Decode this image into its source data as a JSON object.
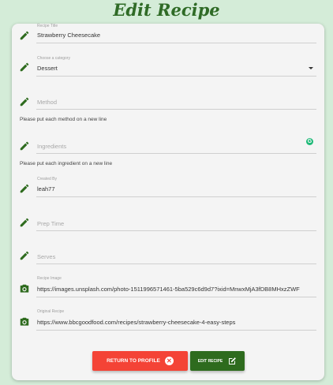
{
  "page": {
    "title": "Edit Recipe"
  },
  "form": {
    "recipe_title": {
      "label": "Recipe Title",
      "value": "Strawberry Cheesecake"
    },
    "category": {
      "label": "Choose a category",
      "value": "Dessert"
    },
    "method": {
      "placeholder": "Method",
      "helper": "Please put each method on a new line"
    },
    "ingredients": {
      "placeholder": "Ingredients",
      "helper": "Please put each ingredient on a new line"
    },
    "created_by": {
      "label": "Created By",
      "value": "leah77"
    },
    "prep_time": {
      "placeholder": "Prep Time"
    },
    "serves": {
      "placeholder": "Serves"
    },
    "recipe_image": {
      "label": "Recipe Image",
      "value": "https://images.unsplash.com/photo-1511996571461-5ba529c6d9d7?ixid=MnwxMjA3fDB8MHxzZWF"
    },
    "original_recipe": {
      "label": "Original Recipe",
      "value": "https://www.bbcgoodfood.com/recipes/strawberry-cheesecake-4-easy-steps"
    }
  },
  "buttons": {
    "return_label": "Return to profile",
    "edit_label": "Edit Recipe"
  },
  "colors": {
    "accent_green": "#2e6b1e",
    "return_red": "#f44336",
    "background": "#d4ecd8"
  },
  "icons": {
    "field": "pencil-icon",
    "image": "camera-icon",
    "return": "close-circle-icon",
    "edit": "edit-square-icon",
    "grammar": "grammarly-icon"
  }
}
